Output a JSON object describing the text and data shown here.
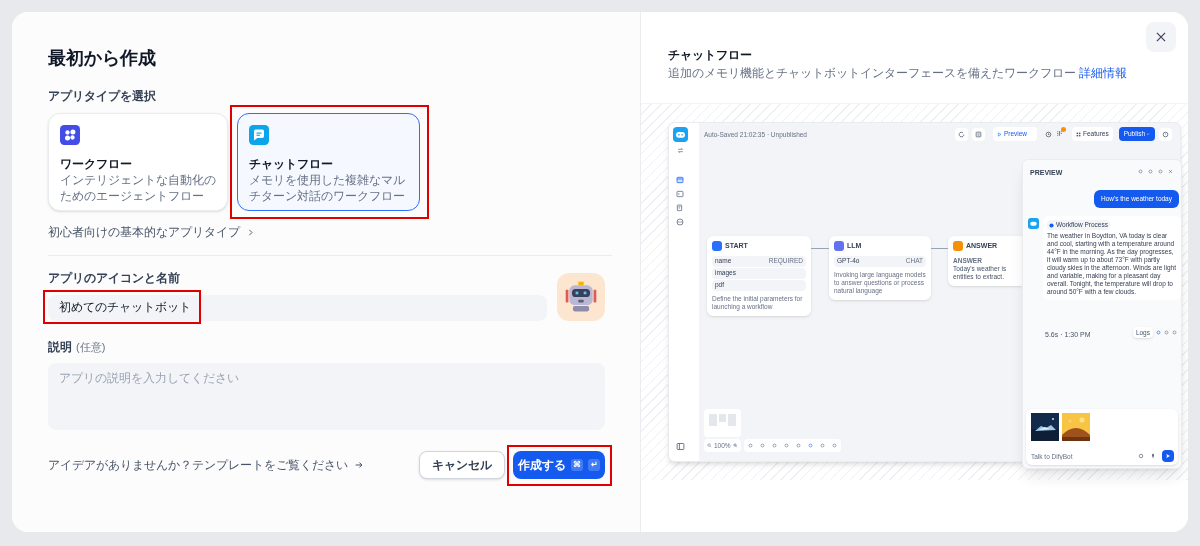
{
  "title": "最初から作成",
  "app_type": {
    "label": "アプリタイプを選択",
    "options": [
      {
        "kind": "workflow",
        "title": "ワークフロー",
        "description": "インテリジェントな自動化のためのエージェントフロー",
        "selected": false,
        "highlighted": false
      },
      {
        "kind": "chatflow",
        "title": "チャットフロー",
        "description": "メモリを使用した複雑なマルチターン対話のワークフロー",
        "selected": true,
        "highlighted": true
      }
    ],
    "beginner_link": "初心者向けの基本的なアプリタイプ"
  },
  "name_field": {
    "label": "アプリのアイコンと名前",
    "value": "初めてのチャットボット",
    "highlighted": true
  },
  "description_field": {
    "label": "説明",
    "optional": "(任意)",
    "placeholder": "アプリの説明を入力してください"
  },
  "template_link": "アイデアがありませんか？テンプレートをご覧ください",
  "cancel_button": "キャンセル",
  "create_button": {
    "label": "作成する",
    "shortcut": [
      "⌘",
      "↵"
    ],
    "highlighted": true
  },
  "preview": {
    "title": "チャットフロー",
    "description": "追加のメモリ機能とチャットボットインターフェースを備えたワークフロー",
    "link": "詳細情報",
    "screenshot": {
      "save_status": "Auto-Saved 21:02:35 · Unpublished",
      "preview_button": "Preview",
      "features_button": "Features",
      "publish_button": "Publish",
      "nodes": [
        {
          "kind": "start",
          "title": "START",
          "variables": [
            {
              "name": "name",
              "tag": "REQUIRED"
            },
            {
              "name": "images"
            },
            {
              "name": "pdf"
            }
          ],
          "description": "Define the initial parameters for launching a workflow"
        },
        {
          "kind": "llm",
          "title": "LLM",
          "model": "GPT-4o",
          "mode": "CHAT",
          "description": "Invoking large language models to answer questions or process natural language"
        },
        {
          "kind": "answer",
          "title": "ANSWER",
          "label": "ANSWER",
          "lines": [
            "Today's weather is",
            "entities to extract."
          ]
        }
      ],
      "zoom": "100%",
      "chat": {
        "title": "PREVIEW",
        "user_message": "How's the weather today",
        "process_label": "Workflow Process",
        "reply": "The weather in Boydton, VA today is clear and cool, starting with a temperature around 44°F in the morning. As the day progresses, it will warm up to about 73°F with partly cloudy skies in the afternoon. Winds are light and variable, making for a pleasant day overall. Tonight, the temperature will drop to around 50°F with a few clouds.",
        "meta": "5.6s · 1:30 PM",
        "logs": "Logs",
        "placeholder": "Talk to DifyBot"
      }
    }
  }
}
